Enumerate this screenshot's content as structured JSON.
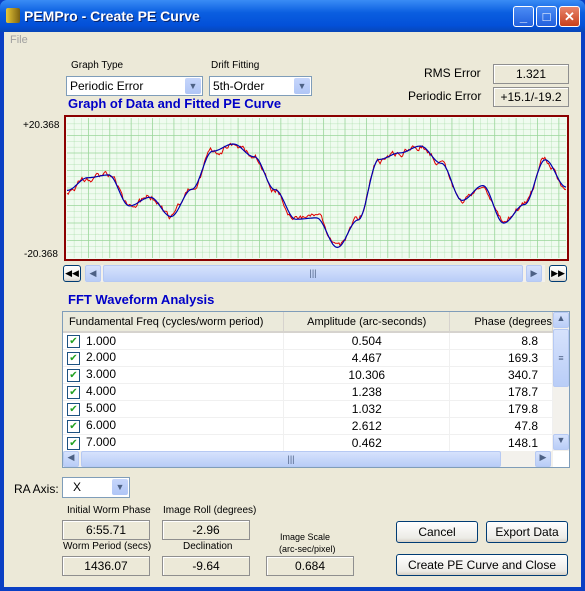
{
  "window": {
    "title": "PEMPro - Create PE Curve",
    "menu": [
      "File"
    ]
  },
  "graph_type": {
    "label": "Graph Type",
    "value": "Periodic Error"
  },
  "drift_fitting": {
    "label": "Drift Fitting",
    "value": "5th-Order"
  },
  "rms_error": {
    "label": "RMS Error",
    "value": "1.321"
  },
  "periodic_error": {
    "label": "Periodic Error",
    "value": "+15.1/-19.2"
  },
  "graph": {
    "title": "Graph of Data and Fitted PE Curve",
    "y_max_label": "+20.368",
    "y_min_label": "-20.368",
    "ylim": [
      -20.368,
      20.368
    ],
    "colors": {
      "data": "#e00000",
      "fit": "#0000b0",
      "grid": "#9ad69a",
      "background": "#effbef",
      "border": "#8b0000"
    },
    "fitted_curve": [
      -0.7,
      3.0,
      3.8,
      -5.2,
      -2.7,
      -8.3,
      -0.4,
      10.7,
      12.8,
      9.1,
      -0.5,
      -9.1,
      -8.7,
      -17.3,
      -9.3,
      8.3,
      10.2,
      12.2,
      7.2,
      -3.6,
      0.7,
      -10.2,
      -4.8,
      8.2,
      0.3
    ]
  },
  "fft": {
    "title": "FFT Waveform Analysis",
    "columns": [
      "Fundamental Freq (cycles/worm period)",
      "Amplitude (arc-seconds)",
      "Phase (degrees"
    ],
    "rows": [
      {
        "freq": "1.000",
        "amp": "0.504",
        "phase": "8.8",
        "checked": true
      },
      {
        "freq": "2.000",
        "amp": "4.467",
        "phase": "169.3",
        "checked": true
      },
      {
        "freq": "3.000",
        "amp": "10.306",
        "phase": "340.7",
        "checked": true
      },
      {
        "freq": "4.000",
        "amp": "1.238",
        "phase": "178.7",
        "checked": true
      },
      {
        "freq": "5.000",
        "amp": "1.032",
        "phase": "179.8",
        "checked": true
      },
      {
        "freq": "6.000",
        "amp": "2.612",
        "phase": "47.8",
        "checked": true
      },
      {
        "freq": "7.000",
        "amp": "0.462",
        "phase": "148.1",
        "checked": true
      }
    ]
  },
  "ra_axis": {
    "label": "RA Axis:",
    "value": "X"
  },
  "fields": {
    "initial_worm_phase": {
      "label": "Initial Worm Phase",
      "value": "6:55.71"
    },
    "image_roll": {
      "label": "Image Roll (degrees)",
      "value": "-2.96"
    },
    "worm_period": {
      "label": "Worm Period (secs)",
      "value": "1436.07"
    },
    "declination": {
      "label": "Declination",
      "value": "-9.64"
    },
    "image_scale": {
      "label1": "Image Scale",
      "label2": "(arc-sec/pixel)",
      "value": "0.684"
    }
  },
  "buttons": {
    "cancel": "Cancel",
    "export": "Export Data",
    "create": "Create PE Curve and Close"
  }
}
